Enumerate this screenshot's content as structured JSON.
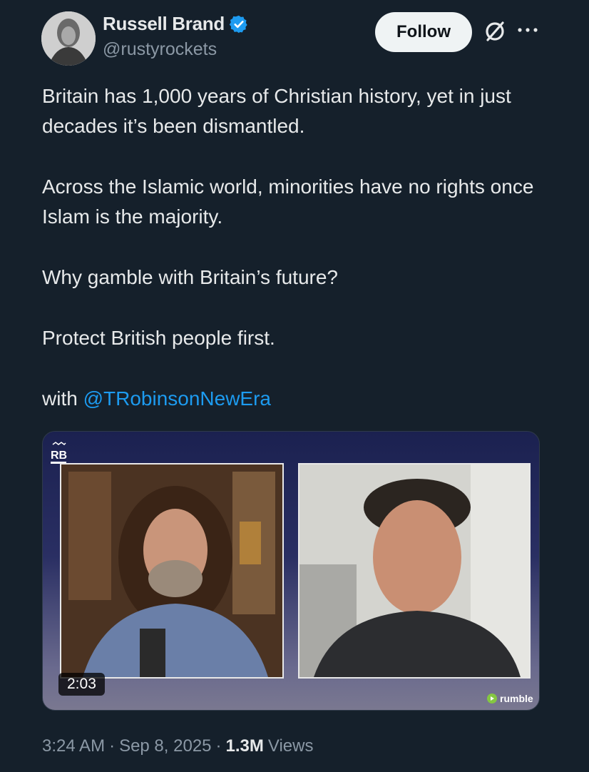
{
  "author": {
    "name": "Russell Brand",
    "handle": "@rustyrockets",
    "verified": true
  },
  "follow_label": "Follow",
  "icons": [
    "grok-icon",
    "more-icon",
    "verified-badge-icon",
    "rumble-logo-icon"
  ],
  "tweet": {
    "paragraphs": [
      "Britain has 1,000 years of Christian history, yet in just decades it’s been dismantled.",
      "Across the Islamic world, minorities have no rights once Islam is the majority.",
      "Why gamble with Britain’s future?",
      "Protect British people first."
    ],
    "with_prefix": "with",
    "mention": "@TRobinsonNewEra"
  },
  "media": {
    "duration": "2:03",
    "provider": "rumble",
    "logo_text": "RB"
  },
  "meta": {
    "time": "3:24 AM",
    "separator": "·",
    "date": "Sep 8, 2025",
    "views_count": "1.3M",
    "views_label": "Views"
  },
  "colors": {
    "background": "#15202b",
    "accent": "#1d9bf0",
    "text": "#e7e9ea",
    "muted": "#8b98a5"
  }
}
